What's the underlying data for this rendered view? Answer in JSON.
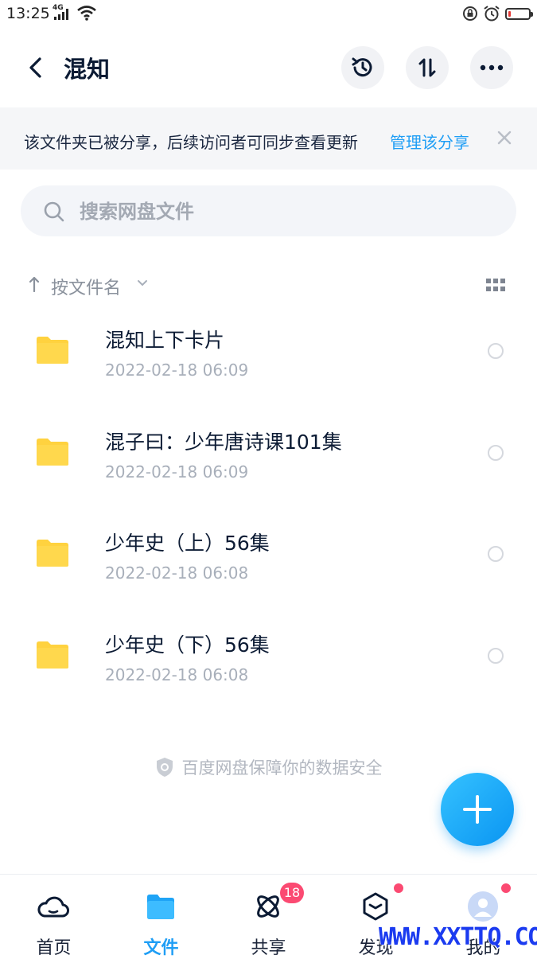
{
  "status_bar": {
    "time": "13:25",
    "network": "4G"
  },
  "header": {
    "title": "混知"
  },
  "banner": {
    "message": "该文件夹已被分享，后续访问者可同步查看更新",
    "link": "管理该分享"
  },
  "search": {
    "placeholder": "搜索网盘文件"
  },
  "sort": {
    "label": "按文件名"
  },
  "files": [
    {
      "name": "混知上下卡片",
      "date": "2022-02-18  06:09"
    },
    {
      "name": "混子曰：少年唐诗课101集",
      "date": "2022-02-18  06:09"
    },
    {
      "name": "少年史（上）56集",
      "date": "2022-02-18  06:08"
    },
    {
      "name": "少年史（下）56集",
      "date": "2022-02-18  06:08"
    }
  ],
  "footer_note": "百度网盘保障你的数据安全",
  "tabs": [
    {
      "label": "首页",
      "icon": "cloud-icon"
    },
    {
      "label": "文件",
      "icon": "folder-icon",
      "active": true
    },
    {
      "label": "共享",
      "icon": "share-orbit-icon",
      "badge": "18"
    },
    {
      "label": "发现",
      "icon": "discover-cube-icon",
      "dot": true
    },
    {
      "label": "我的",
      "icon": "avatar-icon",
      "dot": true
    }
  ],
  "watermark": "WWW.XXTTQ.COM",
  "colors": {
    "accent": "#1f9ef5",
    "badge": "#fb4a72",
    "folder": "#ffd23f"
  }
}
